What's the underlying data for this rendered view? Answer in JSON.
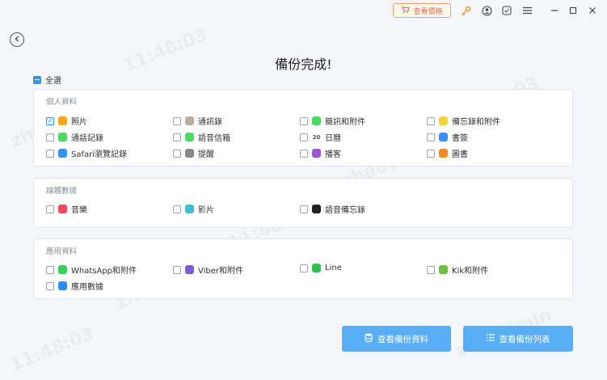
{
  "titlebar": {
    "buy_label": "查看價格",
    "buy_color": "#e5723d",
    "icons": [
      "key-icon",
      "user-icon",
      "feedback-icon",
      "menu-icon",
      "minimize-icon",
      "maximize-icon",
      "close-icon"
    ]
  },
  "page": {
    "title": "備份完成!",
    "select_all_label": "全選"
  },
  "sections": {
    "personal": {
      "title": "個人資料",
      "items": [
        {
          "label": "照片",
          "icon": "photos-icon",
          "color": "#f6a623",
          "checked": true
        },
        {
          "label": "通訊錄",
          "icon": "contacts-icon",
          "color": "#b9b19e",
          "checked": false
        },
        {
          "label": "簡訊和附件",
          "icon": "messages-icon",
          "color": "#4cd964",
          "checked": false
        },
        {
          "label": "備忘錄和附件",
          "icon": "notes-icon",
          "color": "#f5d33a",
          "checked": false
        },
        {
          "label": "通話記錄",
          "icon": "phone-icon",
          "color": "#4cd964",
          "checked": false
        },
        {
          "label": "語音信箱",
          "icon": "voicemail-icon",
          "color": "#4cd964",
          "checked": false
        },
        {
          "label": "日曆",
          "icon": "calendar-icon",
          "color": "#555555",
          "icon_text": "20",
          "checked": false
        },
        {
          "label": "書簽",
          "icon": "bookmarks-icon",
          "color": "#3b8ff0",
          "checked": false
        },
        {
          "label": "Safari瀏覽記錄",
          "icon": "safari-icon",
          "color": "#3b8ff0",
          "checked": false
        },
        {
          "label": "提醒",
          "icon": "reminders-icon",
          "color": "#888888",
          "checked": false
        },
        {
          "label": "播客",
          "icon": "podcasts-icon",
          "color": "#9b59d0",
          "checked": false
        },
        {
          "label": "圖書",
          "icon": "books-icon",
          "color": "#f08a24",
          "checked": false
        }
      ]
    },
    "media": {
      "title": "媒體數據",
      "items": [
        {
          "label": "音樂",
          "icon": "music-icon",
          "color": "#f0475a",
          "checked": false
        },
        {
          "label": "影片",
          "icon": "video-icon",
          "color": "#3ac0d6",
          "checked": false
        },
        {
          "label": "語音備忘錄",
          "icon": "voice-memo-icon",
          "color": "#222222",
          "checked": false
        }
      ]
    },
    "apps": {
      "title": "應用資料",
      "items": [
        {
          "label": "WhatsApp和附件",
          "icon": "whatsapp-icon",
          "color": "#3ccd5a",
          "checked": false
        },
        {
          "label": "Viber和附件",
          "icon": "viber-icon",
          "color": "#7d5bd6",
          "checked": false
        },
        {
          "label": "Line",
          "icon": "line-icon",
          "color": "#2fc24e",
          "checked": false
        },
        {
          "label": "Kik和附件",
          "icon": "kik-icon",
          "color": "#6cc040",
          "checked": false
        },
        {
          "label": "應用數據",
          "icon": "app-store-icon",
          "color": "#2a8cf4",
          "checked": false
        }
      ]
    }
  },
  "actions": {
    "view_backup_data": "查看備份資料",
    "view_backup_list": "查看備份列表"
  },
  "watermark": {
    "user": "zhaoyimin",
    "time": "11:48:03"
  }
}
